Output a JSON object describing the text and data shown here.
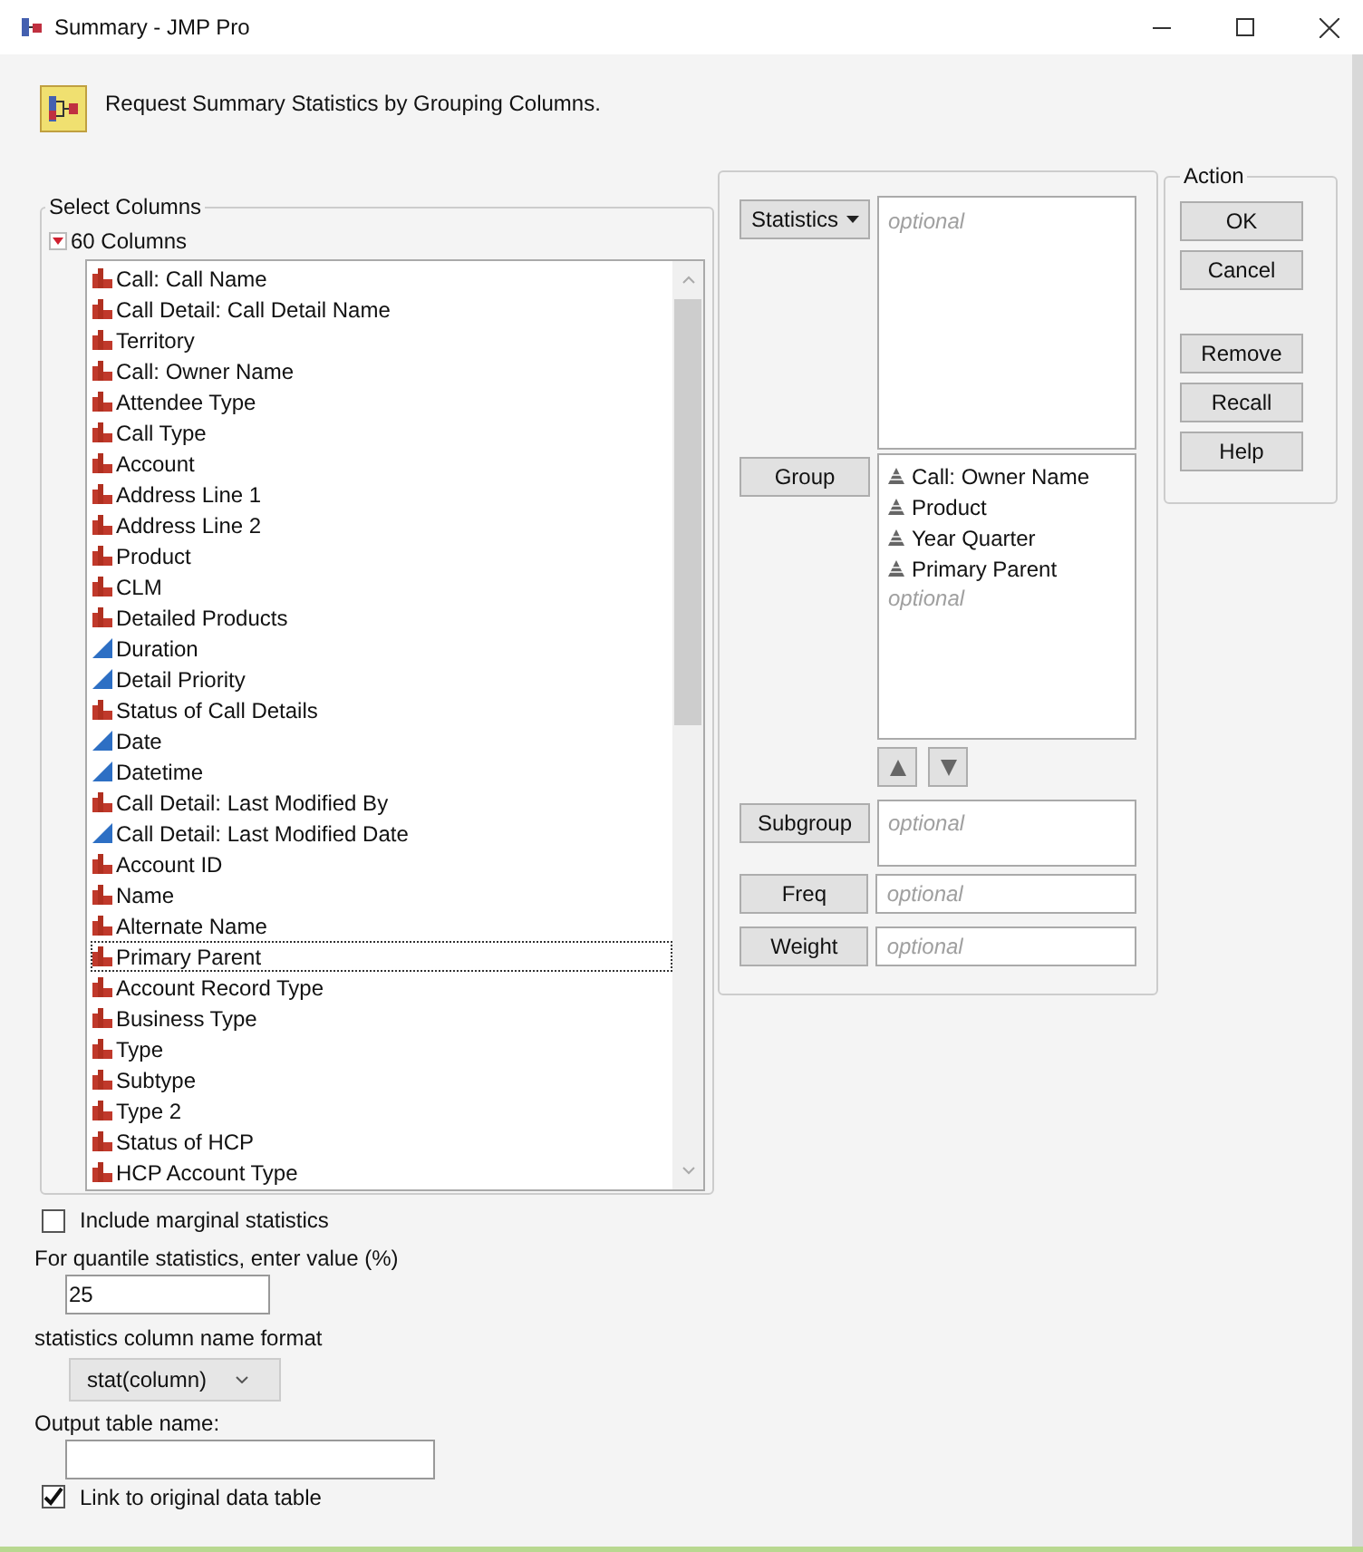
{
  "window": {
    "title": "Summary - JMP Pro"
  },
  "header": {
    "text": "Request Summary Statistics by Grouping Columns."
  },
  "select_columns": {
    "title": "Select Columns",
    "count_label": "60 Columns",
    "expanded": true,
    "columns": [
      {
        "name": "Call: Call Name",
        "kind": "nominal",
        "selected": false
      },
      {
        "name": "Call Detail: Call Detail Name",
        "kind": "nominal",
        "selected": false
      },
      {
        "name": "Territory",
        "kind": "nominal",
        "selected": false
      },
      {
        "name": "Call: Owner Name",
        "kind": "nominal",
        "selected": false
      },
      {
        "name": "Attendee Type",
        "kind": "nominal",
        "selected": false
      },
      {
        "name": "Call Type",
        "kind": "nominal",
        "selected": false
      },
      {
        "name": "Account",
        "kind": "nominal",
        "selected": false
      },
      {
        "name": "Address Line 1",
        "kind": "nominal",
        "selected": false
      },
      {
        "name": "Address Line 2",
        "kind": "nominal",
        "selected": false
      },
      {
        "name": "Product",
        "kind": "nominal",
        "selected": false
      },
      {
        "name": "CLM",
        "kind": "nominal",
        "selected": false
      },
      {
        "name": "Detailed Products",
        "kind": "nominal",
        "selected": false
      },
      {
        "name": "Duration",
        "kind": "continuous",
        "selected": false
      },
      {
        "name": "Detail Priority",
        "kind": "continuous",
        "selected": false
      },
      {
        "name": "Status of Call Details",
        "kind": "nominal",
        "selected": false
      },
      {
        "name": "Date",
        "kind": "continuous",
        "selected": false
      },
      {
        "name": "Datetime",
        "kind": "continuous",
        "selected": false
      },
      {
        "name": "Call Detail: Last Modified By",
        "kind": "nominal",
        "selected": false
      },
      {
        "name": "Call Detail: Last Modified Date",
        "kind": "continuous",
        "selected": false
      },
      {
        "name": "Account ID",
        "kind": "nominal",
        "selected": false
      },
      {
        "name": "Name",
        "kind": "nominal",
        "selected": false
      },
      {
        "name": "Alternate Name",
        "kind": "nominal",
        "selected": false
      },
      {
        "name": "Primary Parent",
        "kind": "nominal",
        "selected": true
      },
      {
        "name": "Account Record Type",
        "kind": "nominal",
        "selected": false
      },
      {
        "name": "Business Type",
        "kind": "nominal",
        "selected": false
      },
      {
        "name": "Type",
        "kind": "nominal",
        "selected": false
      },
      {
        "name": "Subtype",
        "kind": "nominal",
        "selected": false
      },
      {
        "name": "Type 2",
        "kind": "nominal",
        "selected": false
      },
      {
        "name": "Status of HCP",
        "kind": "nominal",
        "selected": false
      },
      {
        "name": "HCP Account Type",
        "kind": "nominal",
        "selected": false
      }
    ]
  },
  "roles": {
    "statistics": {
      "label": "Statistics",
      "placeholder": "optional"
    },
    "group": {
      "label": "Group",
      "items": [
        "Call: Owner Name",
        "Product",
        "Year Quarter",
        "Primary Parent"
      ],
      "placeholder": "optional"
    },
    "subgroup": {
      "label": "Subgroup",
      "placeholder": "optional"
    },
    "freq": {
      "label": "Freq",
      "placeholder": "optional"
    },
    "weight": {
      "label": "Weight",
      "placeholder": "optional"
    }
  },
  "action": {
    "title": "Action",
    "buttons": [
      {
        "label": "OK",
        "gap_before": false
      },
      {
        "label": "Cancel",
        "gap_before": false
      },
      {
        "label": "Remove",
        "gap_before": true
      },
      {
        "label": "Recall",
        "gap_before": false
      },
      {
        "label": "Help",
        "gap_before": false
      }
    ]
  },
  "options": {
    "marginal": {
      "label": "Include marginal statistics",
      "checked": false
    },
    "quantile": {
      "label": "For quantile statistics, enter value (%)",
      "value": "25"
    },
    "name_format": {
      "label": "statistics column name format",
      "value": "stat(column)"
    },
    "output_name": {
      "label": "Output table name:"
    },
    "link": {
      "label": "Link to original data table",
      "checked": true
    }
  }
}
